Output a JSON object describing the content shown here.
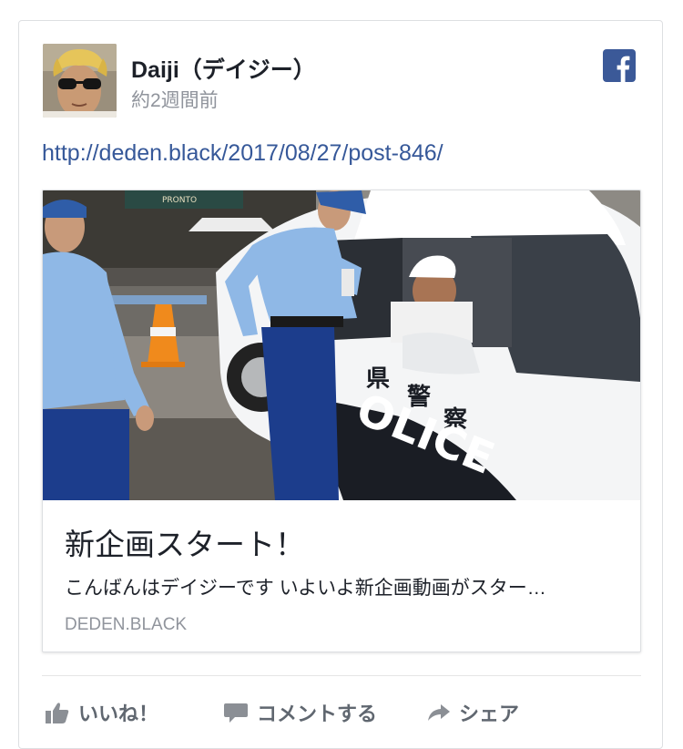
{
  "post": {
    "author": "Daiji（デイジー）",
    "timestamp": "約2週間前",
    "link_url": "http://deden.black/2017/08/27/post-846/",
    "platform_icon": "facebook-icon",
    "brand_color": "#3b5998"
  },
  "attachment": {
    "title": "新企画スタート！",
    "description": "こんばんはデイジーです いよいよ新企画動画がスター…",
    "domain": "DEDEN.BLACK",
    "photo_text": {
      "car_kanji_1": "県",
      "car_kanji_2": "警",
      "car_kanji_3": "察",
      "car_lettering": "OLICE",
      "store_sign": "PRONTO"
    }
  },
  "actions": {
    "like": "いいね！",
    "comment": "コメントする",
    "share": "シェア"
  }
}
